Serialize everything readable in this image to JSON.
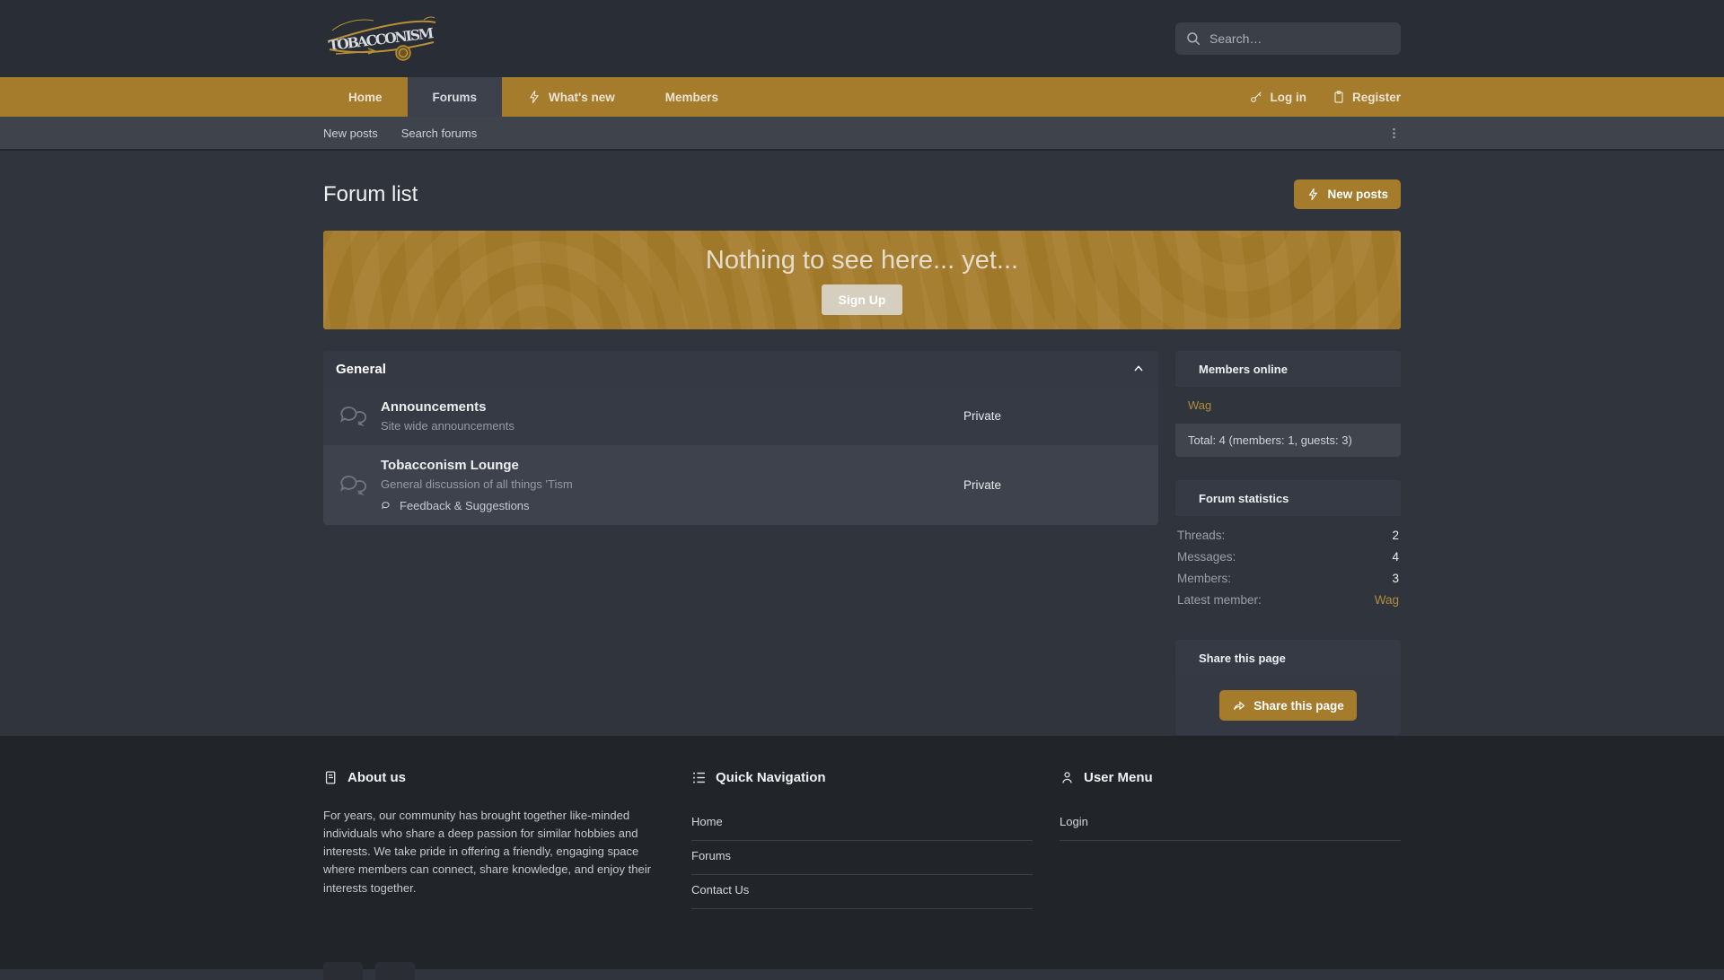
{
  "colors": {
    "accent_gold": "#a57b2c",
    "link_gold": "#b18c3d",
    "header_bg": "#292d35",
    "page_bg": "#30343c",
    "subnav_bg": "#3f434c",
    "card_bg": "#353a44",
    "card_bg_highlight": "#3d424c",
    "footer_bg": "#212428",
    "signup_btn_bg": "#d6cfbf"
  },
  "header": {
    "logo_text": "TOBACCONISM",
    "search": {
      "placeholder": "Search…"
    }
  },
  "nav": {
    "tabs": [
      {
        "label": "Home"
      },
      {
        "label": "Forums"
      },
      {
        "label": "What's new"
      },
      {
        "label": "Members"
      }
    ],
    "login_label": "Log in",
    "register_label": "Register"
  },
  "subnav": {
    "items": [
      {
        "label": "New posts"
      },
      {
        "label": "Search forums"
      }
    ]
  },
  "page": {
    "title": "Forum list",
    "new_posts_button": "New posts"
  },
  "banner": {
    "message": "Nothing to see here... yet...",
    "cta": "Sign Up"
  },
  "category": {
    "title": "General",
    "forums": [
      {
        "title": "Announcements",
        "description": "Site wide announcements",
        "status": "Private"
      },
      {
        "title": "Tobacconism Lounge",
        "description": "General discussion of all things 'Tism",
        "status": "Private",
        "subforum": "Feedback & Suggestions"
      }
    ]
  },
  "sidebar": {
    "members_online": {
      "title": "Members online",
      "members": "Wag",
      "total": "Total: 4 (members: 1, guests: 3)"
    },
    "forum_statistics": {
      "title": "Forum statistics",
      "rows": [
        {
          "label": "Threads:",
          "value": "2"
        },
        {
          "label": "Messages:",
          "value": "4"
        },
        {
          "label": "Members:",
          "value": "3"
        },
        {
          "label": "Latest member:",
          "value": "Wag"
        }
      ]
    },
    "share": {
      "title": "Share this page",
      "button": "Share this page"
    }
  },
  "footer": {
    "about": {
      "title": "About us",
      "text": "For years, our community has brought together like-minded individuals who share a deep passion for similar hobbies and interests. We take pride in offering a friendly, engaging space where members can connect, share knowledge, and enjoy their interests together."
    },
    "quick_nav": {
      "title": "Quick Navigation",
      "links": [
        "Home",
        "Forums",
        "Contact Us"
      ]
    },
    "user_menu": {
      "title": "User Menu",
      "links": [
        "Login"
      ]
    }
  }
}
